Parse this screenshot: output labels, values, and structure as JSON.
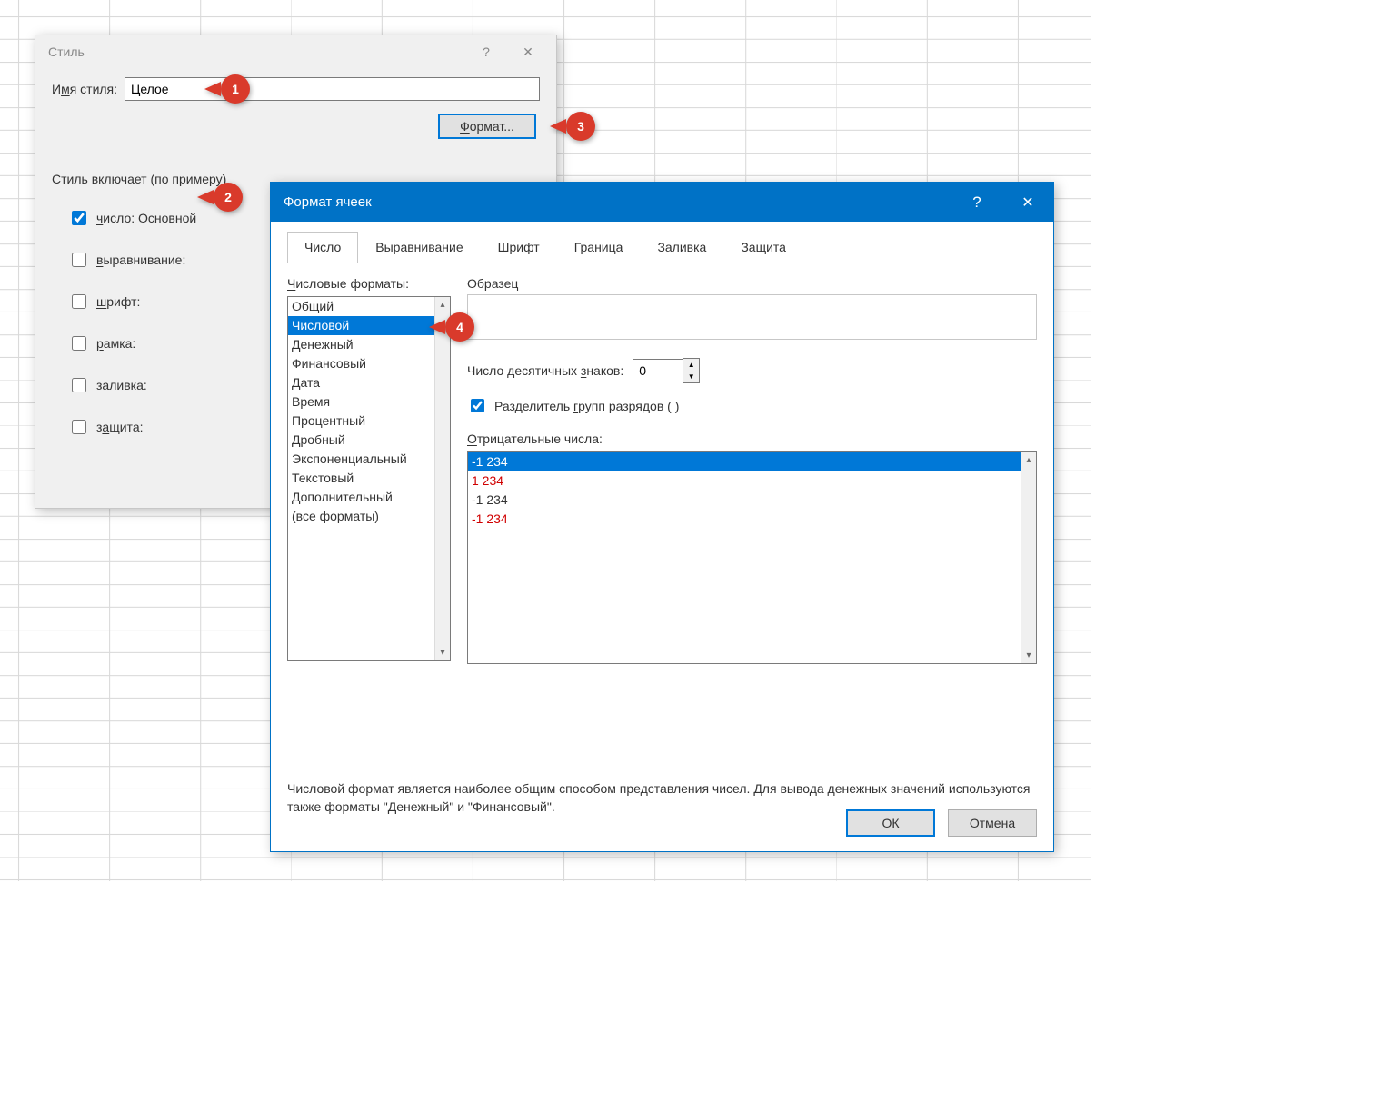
{
  "callouts": {
    "c1": "1",
    "c2": "2",
    "c3": "3",
    "c4": "4"
  },
  "styleDialog": {
    "title": "Стиль",
    "help": "?",
    "close": "✕",
    "name_label_pre": "И",
    "name_label_u": "м",
    "name_label_post": "я стиля:",
    "name_value": "Целое",
    "format_btn_u": "Ф",
    "format_btn_post": "ормат...",
    "section": "Стиль включает (по примеру)",
    "checks": [
      {
        "pre": "",
        "u": "ч",
        "post": "исло: Основной",
        "checked": true
      },
      {
        "pre": "",
        "u": "в",
        "post": "ыравнивание:",
        "checked": false
      },
      {
        "pre": "",
        "u": "ш",
        "post": "рифт:",
        "checked": false
      },
      {
        "pre": "",
        "u": "р",
        "post": "амка:",
        "checked": false
      },
      {
        "pre": "",
        "u": "з",
        "post": "аливка:",
        "checked": false
      },
      {
        "pre": "з",
        "u": "а",
        "post": "щита:",
        "checked": false
      }
    ]
  },
  "formatDialog": {
    "title": "Формат ячеек",
    "help": "?",
    "close": "✕",
    "tabs": [
      "Число",
      "Выравнивание",
      "Шрифт",
      "Граница",
      "Заливка",
      "Защита"
    ],
    "active_tab": 0,
    "cat_label_u": "Ч",
    "cat_label_post": "исловые форматы:",
    "categories": [
      "Общий",
      "Числовой",
      "Денежный",
      "Финансовый",
      "Дата",
      "Время",
      "Процентный",
      "Дробный",
      "Экспоненциальный",
      "Текстовый",
      "Дополнительный",
      "(все форматы)"
    ],
    "selected_category": 1,
    "sample_label": "Образец",
    "dec_label_pre": "Число десятичных ",
    "dec_label_u": "з",
    "dec_label_post": "наков:",
    "dec_value": "0",
    "sep_checked": true,
    "sep_pre": "Разделитель ",
    "sep_u": "г",
    "sep_post": "рупп разрядов ( )",
    "neg_label_u": "О",
    "neg_label_post": "трицательные числа:",
    "neg_items": [
      {
        "text": "-1 234",
        "style": "sel"
      },
      {
        "text": "1 234",
        "style": "red"
      },
      {
        "text": "-1 234",
        "style": "plain"
      },
      {
        "text": "-1 234",
        "style": "red"
      }
    ],
    "description": "Числовой формат является наиболее общим способом представления чисел. Для вывода денежных значений используются также форматы \"Денежный\" и \"Финансовый\".",
    "ok": "ОК",
    "cancel": "Отмена"
  }
}
